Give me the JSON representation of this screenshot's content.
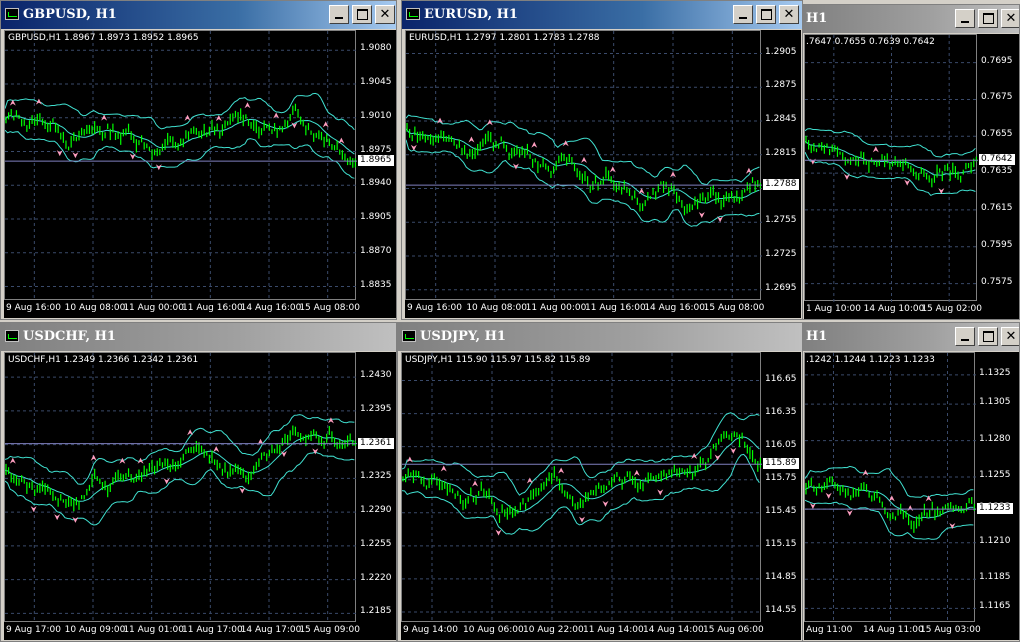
{
  "windows": [
    {
      "id": "gbpusd",
      "title": "GBPUSD, H1",
      "header": "GBPUSD,H1  1.8967 1.8973 1.8952 1.8965",
      "price_tag": "1.8965",
      "y_labels": [
        "1.9080",
        "1.9045",
        "1.9010",
        "1.8975",
        "1.8940",
        "1.8905",
        "1.8870",
        "1.8835"
      ],
      "x_labels": [
        "9 Aug 16:00",
        "10 Aug 08:00",
        "11 Aug 00:00",
        "11 Aug 16:00",
        "14 Aug 16:00",
        "15 Aug 08:00"
      ],
      "ylim": [
        1.882,
        1.91
      ],
      "last": 1.8965,
      "active": true,
      "show_close": true
    },
    {
      "id": "eurusd",
      "title": "EURUSD, H1",
      "header": "EURUSD,H1  1.2797 1.2801 1.2783 1.2788",
      "price_tag": "1.2788",
      "y_labels": [
        "1.2905",
        "1.2875",
        "1.2845",
        "1.2815",
        "1.2785",
        "1.2755",
        "1.2725",
        "1.2695"
      ],
      "x_labels": [
        "9 Aug 16:00",
        "10 Aug 08:00",
        "11 Aug 00:00",
        "11 Aug 16:00",
        "14 Aug 16:00",
        "15 Aug 08:00"
      ],
      "ylim": [
        1.2685,
        1.2925
      ],
      "last": 1.2788,
      "active": true,
      "show_close": true
    },
    {
      "id": "audusd",
      "title": "H1",
      "header": ".7647 0.7655 0.7639 0.7642",
      "price_tag": "0.7642",
      "y_labels": [
        "0.7695",
        "0.7675",
        "0.7655",
        "0.7635",
        "0.7615",
        "0.7595",
        "0.7575"
      ],
      "x_labels": [
        "1 Aug 10:00",
        "14 Aug 10:00",
        "15 Aug 02:00"
      ],
      "ylim": [
        0.7565,
        0.771
      ],
      "last": 0.7642,
      "active": false,
      "show_close": true
    },
    {
      "id": "usdchf",
      "title": "USDCHF, H1",
      "header": "USDCHF,H1  1.2349 1.2366 1.2342 1.2361",
      "price_tag": "1.2361",
      "y_labels": [
        "1.2430",
        "1.2395",
        "1.2360",
        "1.2325",
        "1.2290",
        "1.2255",
        "1.2220",
        "1.2185"
      ],
      "x_labels": [
        "9 Aug 17:00",
        "10 Aug 09:00",
        "11 Aug 01:00",
        "11 Aug 17:00",
        "14 Aug 17:00",
        "15 Aug 09:00"
      ],
      "ylim": [
        1.2175,
        1.2455
      ],
      "last": 1.2361,
      "active": false,
      "show_close": false
    },
    {
      "id": "usdjpy",
      "title": "USDJPY, H1",
      "header": "USDJPY,H1  115.90 115.97 115.82 115.89",
      "price_tag": "115.89",
      "y_labels": [
        "116.65",
        "116.35",
        "116.05",
        "115.75",
        "115.45",
        "115.15",
        "114.85",
        "114.55"
      ],
      "x_labels": [
        "9 Aug 14:00",
        "10 Aug 06:00",
        "10 Aug 22:00",
        "11 Aug 14:00",
        "14 Aug 14:00",
        "15 Aug 06:00"
      ],
      "ylim": [
        114.45,
        116.9
      ],
      "last": 115.89,
      "active": false,
      "show_close": false
    },
    {
      "id": "usdcad",
      "title": "H1",
      "header": ".1242 1.1244 1.1223 1.1233",
      "price_tag": "1.1233",
      "y_labels": [
        "1.1325",
        "1.1305",
        "1.1280",
        "1.1255",
        "1.1233",
        "1.1210",
        "1.1185",
        "1.1165"
      ],
      "x_labels": [
        "Aug 11:00",
        "14 Aug 11:00",
        "15 Aug 03:00"
      ],
      "ylim": [
        1.1155,
        1.134
      ],
      "last": 1.1233,
      "active": false,
      "show_close": false
    }
  ]
}
